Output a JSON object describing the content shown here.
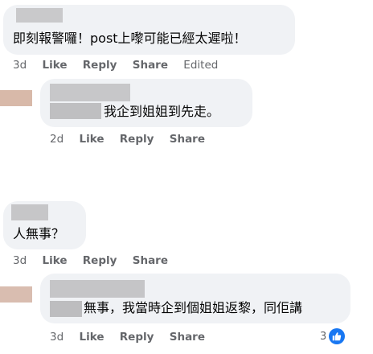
{
  "comments": [
    {
      "text": "即刻報警囉！post上嚟可能已經太遲啦！",
      "time": "3d",
      "like": "Like",
      "reply": "Reply",
      "share": "Share",
      "edited": "Edited"
    },
    {
      "text": "我企到姐姐到先走。",
      "time": "2d",
      "like": "Like",
      "reply": "Reply",
      "share": "Share"
    },
    {
      "text": "人無事？",
      "time": "3d",
      "like": "Like",
      "reply": "Reply",
      "share": "Share"
    },
    {
      "text": "無事，我當時企到個姐姐返黎，同佢講",
      "time": "3d",
      "like": "Like",
      "reply": "Reply",
      "share": "Share",
      "reaction_count": "3"
    }
  ],
  "colors": {
    "bubble": "#f0f2f5",
    "meta_text": "#65676b",
    "like_blue": "#1877f2"
  },
  "icons": {
    "reaction": "thumbs-up-icon"
  }
}
